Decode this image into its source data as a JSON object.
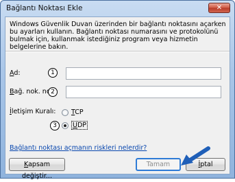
{
  "window": {
    "title": "Bağlantı Noktası Ekle",
    "close_glyph": "✕"
  },
  "description": "Windows Güvenlik Duvan üzerinden bir bağlantı noktasını açarken bu ayarları kullanın. Bağlantı noktası numarasını ve protokolünü bulmak için, kullanmak istediğiniz program veya hizmetin belgelerine bakın.",
  "form": {
    "name_label_first": "A",
    "name_label_rest": "d:",
    "name_marker": "1",
    "name_value": "",
    "port_label_first": "B",
    "port_label_rest": "ağ. nok. no:",
    "port_marker": "2",
    "port_value": "",
    "protocol_label_first": "İ",
    "protocol_label_rest": "letişim Kuralı:",
    "protocol_marker": "3",
    "protocol_options": [
      {
        "label_first": "T",
        "label_rest": "CP",
        "selected": false
      },
      {
        "label_first": "U",
        "label_rest": "DP",
        "selected": true
      }
    ]
  },
  "risk_link": "Bağlantı noktası açmanın riskleri nelerdir?",
  "buttons": {
    "change_scope_first": "K",
    "change_scope_rest": "apsam değiştir...",
    "ok": "Tamam",
    "cancel_first": "İ",
    "cancel_rest": "ptal"
  },
  "colors": {
    "accent_arrow": "#1f5fb8",
    "link": "#0645ad",
    "focus_border": "#2e7bd6"
  },
  "icons": [
    "close-icon",
    "pointer-arrow-icon"
  ]
}
